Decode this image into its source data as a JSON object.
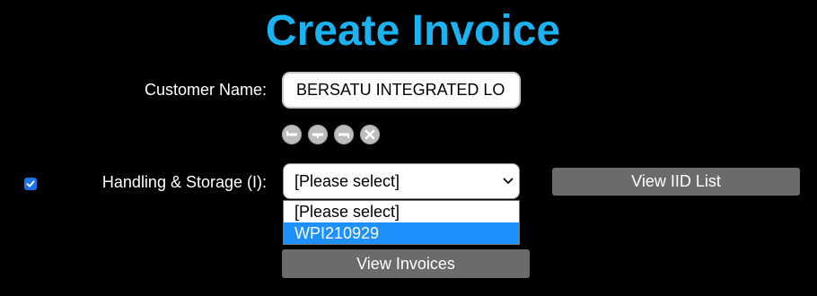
{
  "page": {
    "title": "Create Invoice"
  },
  "customer": {
    "label": "Customer Name:",
    "value": "BERSATU INTEGRATED LO"
  },
  "icons": [
    {
      "name": "minus-left-icon"
    },
    {
      "name": "minus-center-icon"
    },
    {
      "name": "minus-right-icon"
    },
    {
      "name": "close-icon"
    }
  ],
  "handling": {
    "checked": true,
    "label": "Handling & Storage (I):",
    "select_value": "[Please select]",
    "options": [
      "[Please select]",
      "WPI210929"
    ],
    "highlighted_option": "WPI210929"
  },
  "buttons": {
    "view_iid_list": "View IID List",
    "view_invoices": "View Invoices"
  },
  "colors": {
    "title": "#1ab2f0",
    "button_bg": "#6b6b6b",
    "highlight": "#1e90ff",
    "checkbox": "#1a73e8"
  }
}
